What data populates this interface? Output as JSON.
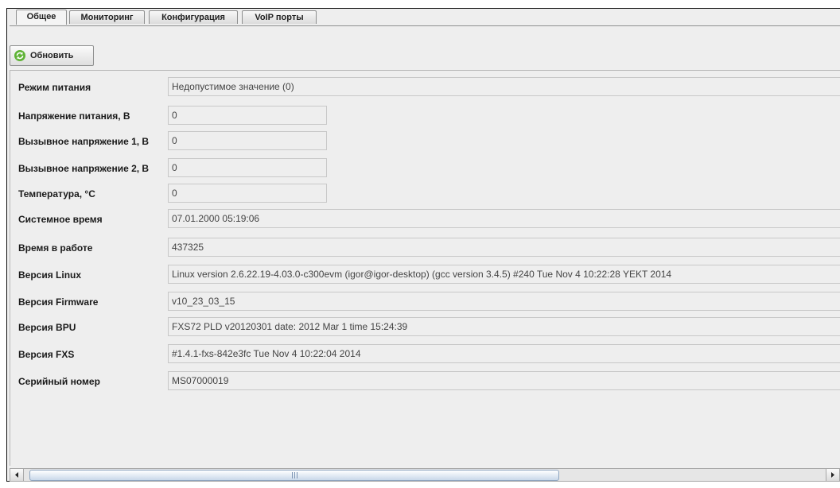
{
  "tabs": [
    "Общее",
    "Мониторинг",
    "Конфигурация",
    "VoIP порты"
  ],
  "refresh_button": {
    "label": "Обновить",
    "icon": "refresh-icon"
  },
  "rows": [
    {
      "label": "Режим питания",
      "value": "Недопустимое значение (0)"
    },
    {
      "label": "Напряжение питания, В",
      "value": "0"
    },
    {
      "label": "Вызывное напряжение 1, В",
      "value": "0"
    },
    {
      "label": "Вызывное напряжение 2, В",
      "value": "0"
    },
    {
      "label": "Температура, °С",
      "value": "0"
    },
    {
      "label": "Системное время",
      "value": "07.01.2000 05:19:06"
    },
    {
      "label": "Время в работе",
      "value": "437325"
    },
    {
      "label": "Версия Linux",
      "value": "Linux version 2.6.22.19-4.03.0-c300evm (igor@igor-desktop) (gcc version 3.4.5) #240 Tue Nov 4 10:22:28 YEKT 2014"
    },
    {
      "label": "Версия Firmware",
      "value": "v10_23_03_15"
    },
    {
      "label": "Версия BPU",
      "value": "FXS72 PLD v20120301 date: 2012 Mar 1 time 15:24:39"
    },
    {
      "label": "Версия FXS",
      "value": "#1.4.1-fxs-842e3fc Tue Nov  4 10:22:04 2014"
    },
    {
      "label": "Серийный номер",
      "value": "MS07000019"
    }
  ],
  "colors": {
    "accent": "#c9d8ea",
    "panel": "#eeeeee",
    "border": "#8e8f8f"
  }
}
